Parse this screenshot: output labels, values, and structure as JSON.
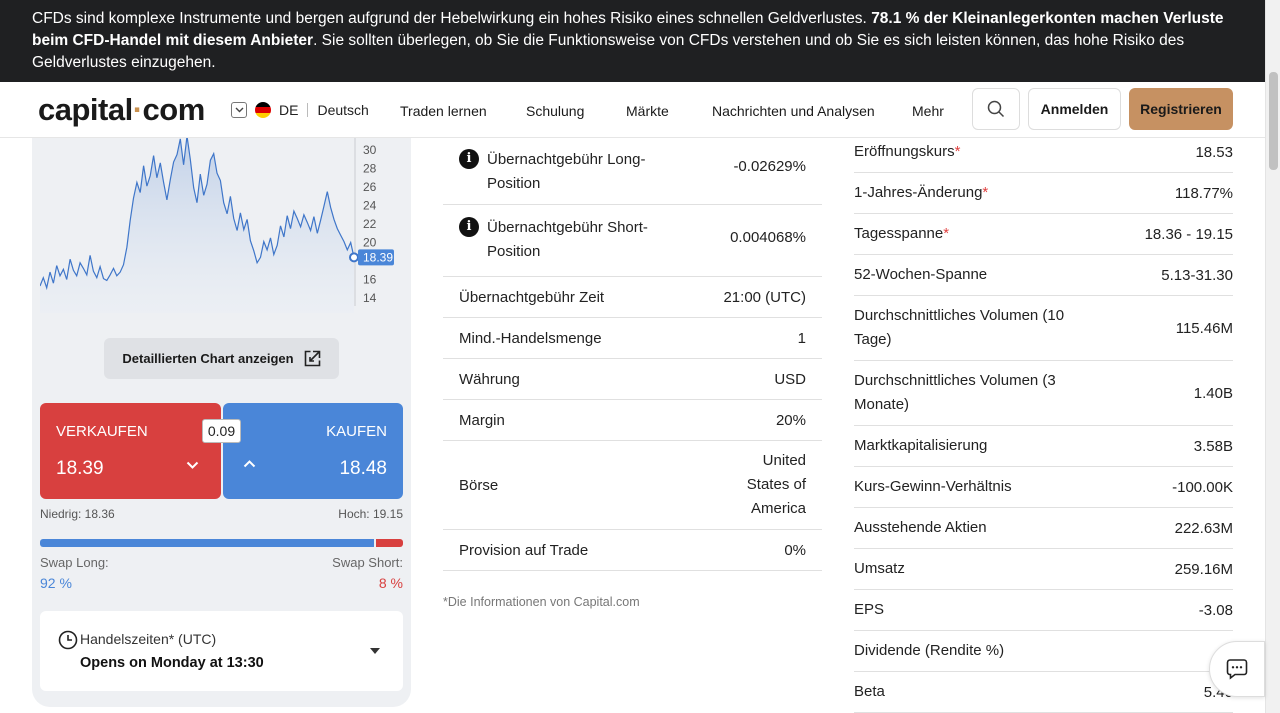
{
  "risk": {
    "text_before": "CFDs sind komplexe Instrumente und bergen aufgrund der Hebelwirkung ein hohes Risiko eines schnellen Geldverlustes. ",
    "text_bold": "78.1 % der Kleinanlegerkonten machen Verluste beim CFD-Handel mit diesem Anbieter",
    "text_after": ". Sie sollten überlegen, ob Sie die Funktionsweise von CFDs verstehen und ob Sie es sich leisten können, das hohe Risiko des Geldverlustes einzugehen."
  },
  "header": {
    "logo_left": "capital",
    "logo_dot": "·",
    "logo_right": "com",
    "region": "DE",
    "language": "Deutsch",
    "nav": [
      "Traden lernen",
      "Schulung",
      "Märkte",
      "Nachrichten und Analysen",
      "Mehr"
    ],
    "login": "Anmelden",
    "register": "Registrieren"
  },
  "chart": {
    "y_ticks": [
      "30",
      "28",
      "26",
      "24",
      "22",
      "20",
      "16",
      "14"
    ],
    "current_price": "18.39"
  },
  "chart_data": {
    "type": "area",
    "y_ticks": [
      30,
      28,
      26,
      24,
      22,
      20,
      18,
      16,
      14
    ],
    "ylim": [
      13,
      31.5
    ],
    "values": [
      15.3,
      16.2,
      15.1,
      16.8,
      15.6,
      17.5,
      16.4,
      17.1,
      16.0,
      18.2,
      17.0,
      16.4,
      17.8,
      17.2,
      16.5,
      18.6,
      16.9,
      16.2,
      17.4,
      16.1,
      15.9,
      16.5,
      17.2,
      16.4,
      16.8,
      17.6,
      19.5,
      22.4,
      24.8,
      26.5,
      25.4,
      28.3,
      26.1,
      27.2,
      29.4,
      27.0,
      28.6,
      26.5,
      24.6,
      26.8,
      28.7,
      29.5,
      31.2,
      28.4,
      31.5,
      29.0,
      25.9,
      24.3,
      27.4,
      25.1,
      26.3,
      28.9,
      29.6,
      27.5,
      26.7,
      24.3,
      23.1,
      25.0,
      22.6,
      21.3,
      23.2,
      21.4,
      22.5,
      20.2,
      19.1,
      17.8,
      18.4,
      20.1,
      19.2,
      20.5,
      18.7,
      19.7,
      21.8,
      20.6,
      22.9,
      21.5,
      23.4,
      22.6,
      21.7,
      23.0,
      22.2,
      21.3,
      22.8,
      21.0,
      22.4,
      23.9,
      25.5,
      23.8,
      22.5,
      21.5,
      20.8,
      20.1,
      19.2,
      20.0,
      18.39
    ]
  },
  "detail_button": "Detaillierten Chart anzeigen",
  "trade": {
    "sell_label": "VERKAUFEN",
    "sell_price": "18.39",
    "buy_label": "KAUFEN",
    "buy_price": "18.48",
    "spread": "0.09",
    "low": "Niedrig: 18.36",
    "high": "Hoch: 19.15",
    "swap_long_label": "Swap Long:",
    "swap_long_value": "92 %",
    "swap_short_label": "Swap Short:",
    "swap_short_value": "8 %",
    "swap_long_fraction": 0.92
  },
  "hours": {
    "label": "Handelszeiten* (UTC)",
    "value": "Opens on Monday at 13:30"
  },
  "details": [
    {
      "label": "Übernachtgebühr Long-Position",
      "value": "-0.02629%",
      "info": true
    },
    {
      "label": "Übernachtgebühr Short-Position",
      "value": "0.004068%",
      "info": true
    },
    {
      "label": "Übernachtgebühr Zeit",
      "value": "21:00 (UTC)",
      "info": false
    },
    {
      "label": "Mind.-Handelsmenge",
      "value": "1",
      "info": false
    },
    {
      "label": "Währung",
      "value": "USD",
      "info": false
    },
    {
      "label": "Margin",
      "value": "20%",
      "info": false
    },
    {
      "label": "Börse",
      "value": "United States of America",
      "info": false
    },
    {
      "label": "Provision auf Trade",
      "value": "0%",
      "info": false
    }
  ],
  "footnote": "*Die Informationen von Capital.com",
  "stats": [
    {
      "label": "Eröffnungskurs",
      "star": true,
      "value": "18.53"
    },
    {
      "label": "1-Jahres-Änderung",
      "star": true,
      "value": "118.77%"
    },
    {
      "label": "Tagesspanne",
      "star": true,
      "value": "18.36 - 19.15"
    },
    {
      "label": "52-Wochen-Spanne",
      "star": false,
      "value": "5.13-31.30"
    },
    {
      "label": "Durchschnittliches Volumen (10 Tage)",
      "star": false,
      "value": "115.46M"
    },
    {
      "label": "Durchschnittliches Volumen (3 Monate)",
      "star": false,
      "value": "1.40B"
    },
    {
      "label": "Marktkapitalisierung",
      "star": false,
      "value": "3.58B"
    },
    {
      "label": "Kurs-Gewinn-Verhältnis",
      "star": false,
      "value": "-100.00K"
    },
    {
      "label": "Ausstehende Aktien",
      "star": false,
      "value": "222.63M"
    },
    {
      "label": "Umsatz",
      "star": false,
      "value": "259.16M"
    },
    {
      "label": "EPS",
      "star": false,
      "value": "-3.08"
    },
    {
      "label": "Dividende (Rendite %)",
      "star": false,
      "value": "N"
    },
    {
      "label": "Beta",
      "star": false,
      "value": "5.40"
    }
  ],
  "colors": {
    "accent": "#c69162",
    "sell": "#d8403f",
    "buy": "#4a86d8",
    "banner": "#1f2022"
  }
}
